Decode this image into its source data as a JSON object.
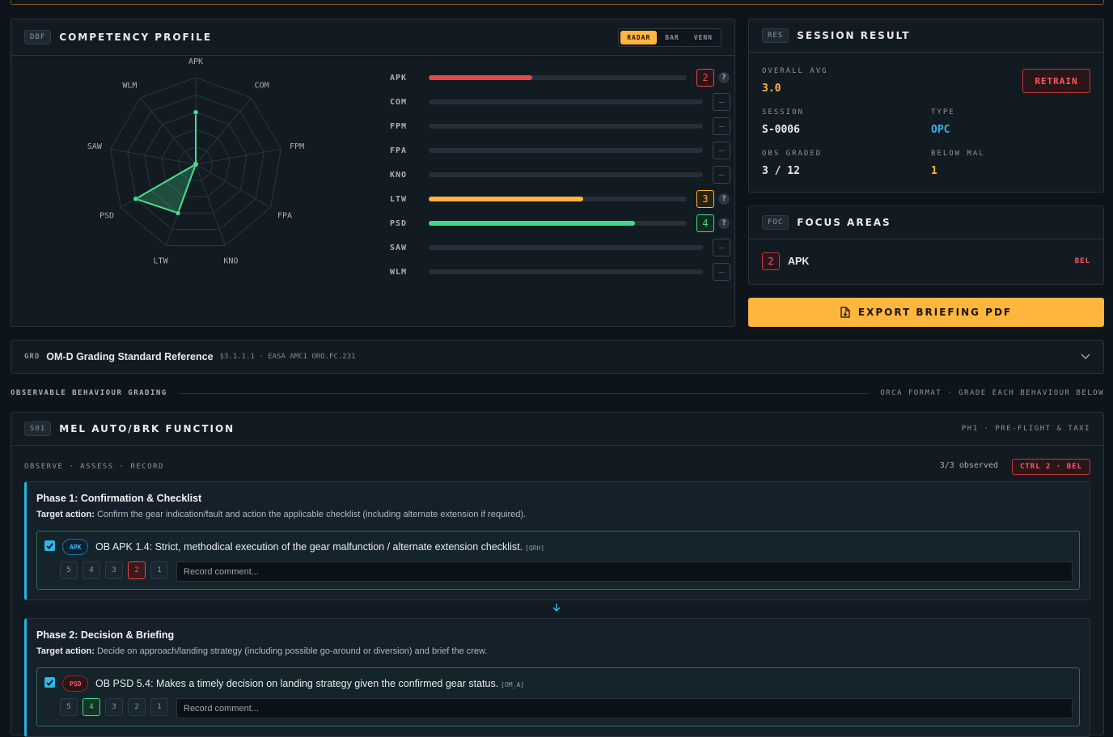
{
  "competency": {
    "tag": "DBF",
    "title": "COMPETENCY PROFILE",
    "view_modes": [
      "RADAR",
      "BAR",
      "VENN"
    ],
    "active_view": "RADAR",
    "radar_axes": [
      "APK",
      "COM",
      "FPM",
      "FPA",
      "KNO",
      "LTW",
      "PSD",
      "SAW",
      "WLM"
    ],
    "radar_max": 5,
    "radar_values": [
      3,
      0,
      0,
      0,
      0,
      3,
      4,
      0,
      0
    ],
    "bars": [
      {
        "code": "APK",
        "grade": "2",
        "level": 2,
        "help": "?",
        "color": "#e8484b"
      },
      {
        "code": "COM",
        "grade": "–",
        "level": 0,
        "help": ""
      },
      {
        "code": "FPM",
        "grade": "–",
        "level": 0,
        "help": ""
      },
      {
        "code": "FPA",
        "grade": "–",
        "level": 0,
        "help": ""
      },
      {
        "code": "KNO",
        "grade": "–",
        "level": 0,
        "help": ""
      },
      {
        "code": "LTW",
        "grade": "3",
        "level": 3,
        "help": "?",
        "color": "#ffb63d"
      },
      {
        "code": "PSD",
        "grade": "4",
        "level": 4,
        "help": "?",
        "color": "#3fd98a"
      },
      {
        "code": "SAW",
        "grade": "–",
        "level": 0,
        "help": ""
      },
      {
        "code": "WLM",
        "grade": "–",
        "level": 0,
        "help": ""
      }
    ]
  },
  "session": {
    "tag": "RES",
    "title": "SESSION RESULT",
    "overall_label": "OVERALL AVG",
    "overall_value": "3.0",
    "retrain_label": "RETRAIN",
    "session_label": "SESSION",
    "session_value": "S-0006",
    "type_label": "TYPE",
    "type_value": "OPC",
    "obs_label": "OBS GRADED",
    "obs_value": "3 / 12",
    "below_label": "BELOW MAL",
    "below_value": "1"
  },
  "focus": {
    "tag": "FOC",
    "title": "FOCUS AREAS",
    "items": [
      {
        "grade": "2",
        "code": "APK",
        "status": "BEL"
      }
    ]
  },
  "export_label": "EXPORT BRIEFING PDF",
  "reference": {
    "tag": "GRD",
    "title": "OM-D Grading Standard Reference",
    "meta": "§3.1.1.1 · EASA AMC1 ORO.FC.231"
  },
  "section_divider": {
    "left": "OBSERVABLE BEHAVIOUR GRADING",
    "right": "ORCA FORMAT · GRADE EACH BEHAVIOUR BELOW"
  },
  "scenario": {
    "tag": "S01",
    "title": "MEL AUTO/BRK FUNCTION",
    "phase_meta": "PH1 · PRE-FLIGHT & TAXI",
    "instruction": "OBSERVE · ASSESS · RECORD",
    "observed": "3/3 observed",
    "status_badge": "CTRL 2 · BEL",
    "target_label": "Target action:",
    "comment_placeholder": "Record comment...",
    "grade_options": [
      "5",
      "4",
      "3",
      "2",
      "1"
    ],
    "phases": [
      {
        "title": "Phase 1: Confirmation & Checklist",
        "target": "Confirm the gear indication/fault and action the applicable checklist (including alternate extension if required).",
        "ob": {
          "comp": "APK",
          "text": "OB APK 1.4: Strict, methodical execution of the gear malfunction / alternate extension checklist.",
          "ref": "[QRH]",
          "selected": "2"
        }
      },
      {
        "title": "Phase 2: Decision & Briefing",
        "target": "Decide on approach/landing strategy (including possible go-around or diversion) and brief the crew.",
        "ob": {
          "comp": "PSD",
          "text": "OB PSD 5.4: Makes a timely decision on landing strategy given the confirmed gear status.",
          "ref": "[OM_A]",
          "selected": "4"
        }
      }
    ]
  }
}
